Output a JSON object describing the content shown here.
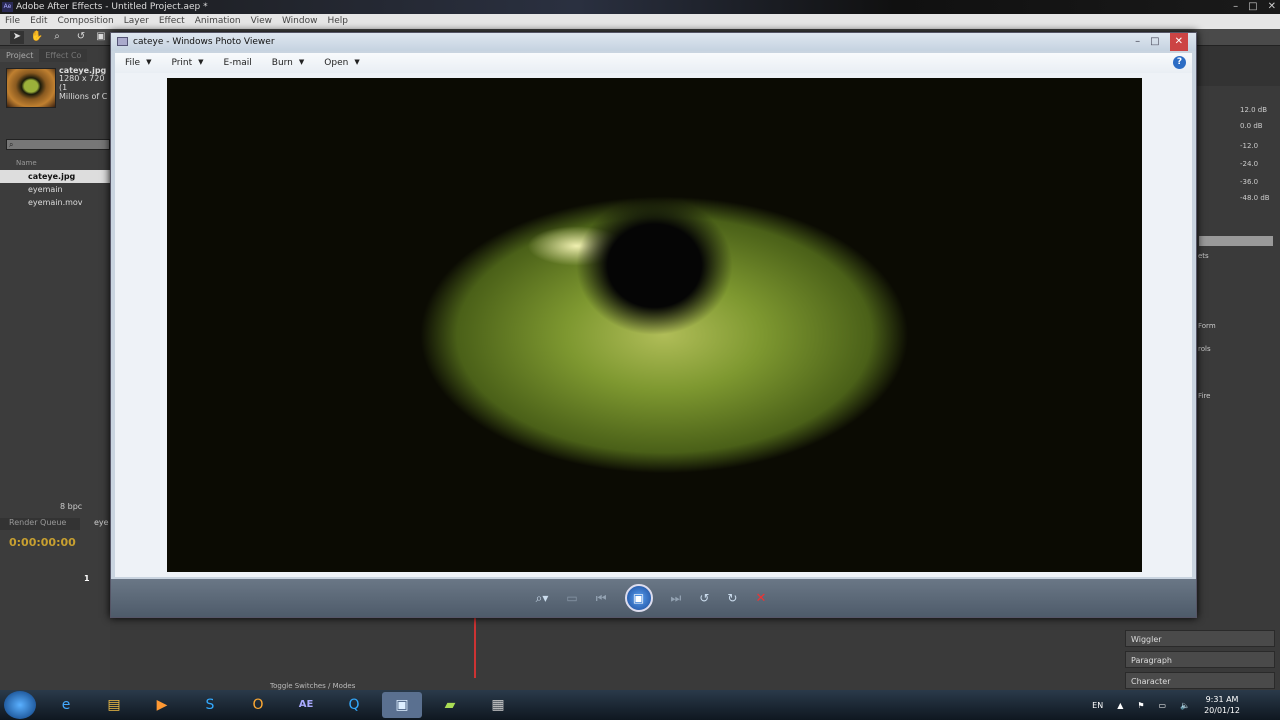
{
  "ae": {
    "title": "Adobe After Effects - Untitled Project.aep *",
    "icon": "Ae",
    "menu": [
      "File",
      "Edit",
      "Composition",
      "Layer",
      "Effect",
      "Animation",
      "View",
      "Window",
      "Help"
    ],
    "project_tab": "Project",
    "effect_tab": "Effect Co",
    "asset": {
      "name": "cateye.jpg",
      "dims": "1280 x 720 (1",
      "color": "Millions of C"
    },
    "name_col": "Name",
    "items": [
      "cateye.jpg",
      "eyemain",
      "eyemain.mov"
    ],
    "bpc": "8 bpc",
    "render_queue": "Render Queue",
    "comp_tab": "eye",
    "timecode": "0:00:00:00",
    "layer_num": "1",
    "toggle": "Toggle Switches / Modes",
    "audio_levels": [
      "12.0 dB",
      "0.0 dB",
      "-12.0",
      "-24.0",
      "-36.0",
      "-48.0 dB"
    ],
    "right_list": [
      "ets",
      "Form",
      "rols",
      "Fire"
    ],
    "panels": [
      "Wiggler",
      "Paragraph",
      "Character"
    ]
  },
  "viewer": {
    "title": "cateye - Windows Photo Viewer",
    "menu": [
      {
        "label": "File",
        "dropdown": true
      },
      {
        "label": "Print",
        "dropdown": true
      },
      {
        "label": "E-mail",
        "dropdown": false
      },
      {
        "label": "Burn",
        "dropdown": true
      },
      {
        "label": "Open",
        "dropdown": true
      }
    ],
    "help": "?"
  },
  "taskbar": {
    "lang": "EN",
    "time": "9:31 AM",
    "date": "20/01/12",
    "ae_label": "AE"
  },
  "colors": {
    "timecode": "#c8a030",
    "accent": "#2c6cc4"
  }
}
